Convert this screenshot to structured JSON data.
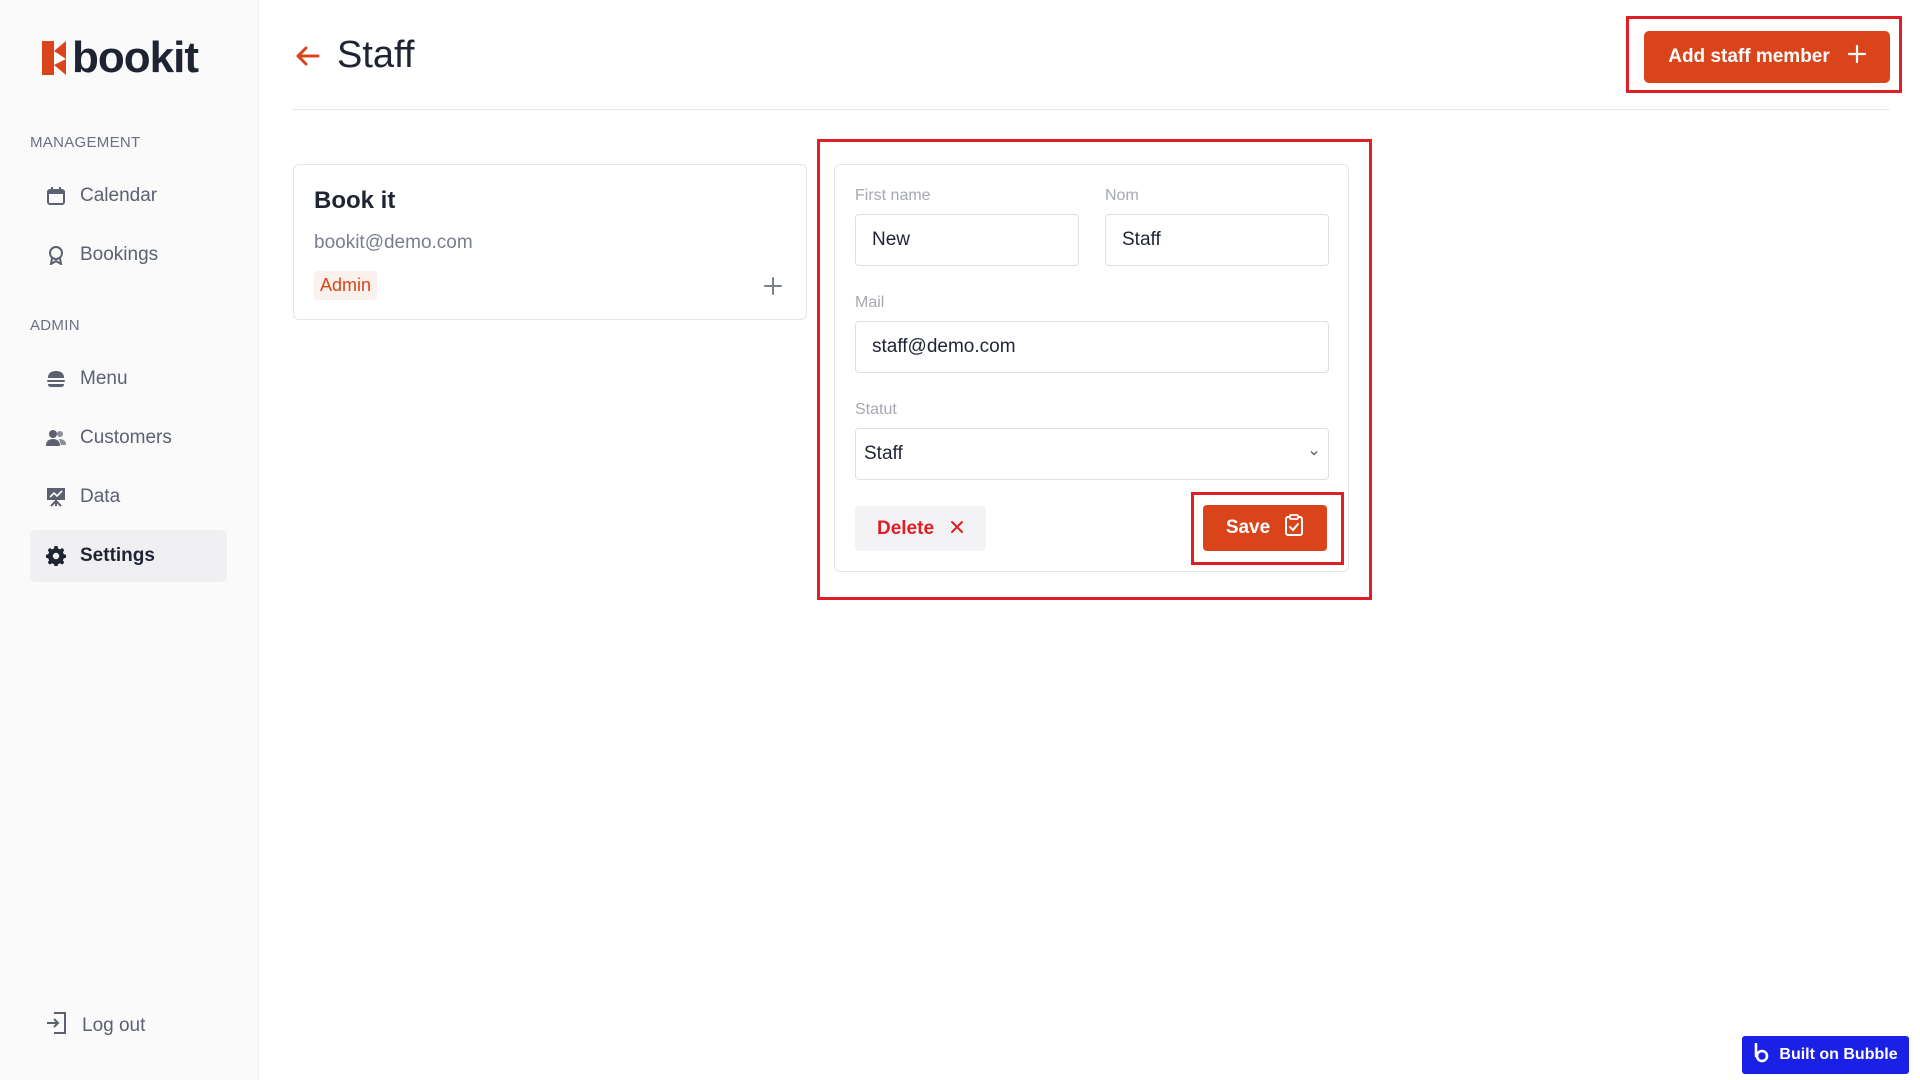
{
  "brand": {
    "name": "bookit",
    "accent": "#d9441a"
  },
  "sidebar": {
    "management_label": "MANAGEMENT",
    "admin_label": "ADMIN",
    "items": [
      {
        "label": "Calendar",
        "icon": "calendar-icon"
      },
      {
        "label": "Bookings",
        "icon": "ribbon-icon"
      },
      {
        "label": "Menu",
        "icon": "burger-icon"
      },
      {
        "label": "Customers",
        "icon": "users-icon"
      },
      {
        "label": "Data",
        "icon": "chart-board-icon"
      },
      {
        "label": "Settings",
        "icon": "gear-icon",
        "active": true
      }
    ],
    "logout_label": "Log out"
  },
  "header": {
    "title": "Staff",
    "add_button_label": "Add staff member"
  },
  "staff_card": {
    "name": "Book it",
    "email": "bookit@demo.com",
    "role": "Admin"
  },
  "form": {
    "first_name_label": "First name",
    "first_name_value": "New",
    "last_name_label": "Nom",
    "last_name_value": "Staff",
    "mail_label": "Mail",
    "mail_value": "staff@demo.com",
    "status_label": "Statut",
    "status_value": "Staff",
    "delete_label": "Delete",
    "save_label": "Save"
  },
  "badge": {
    "label": "Built on Bubble",
    "color": "#1a20e6"
  }
}
